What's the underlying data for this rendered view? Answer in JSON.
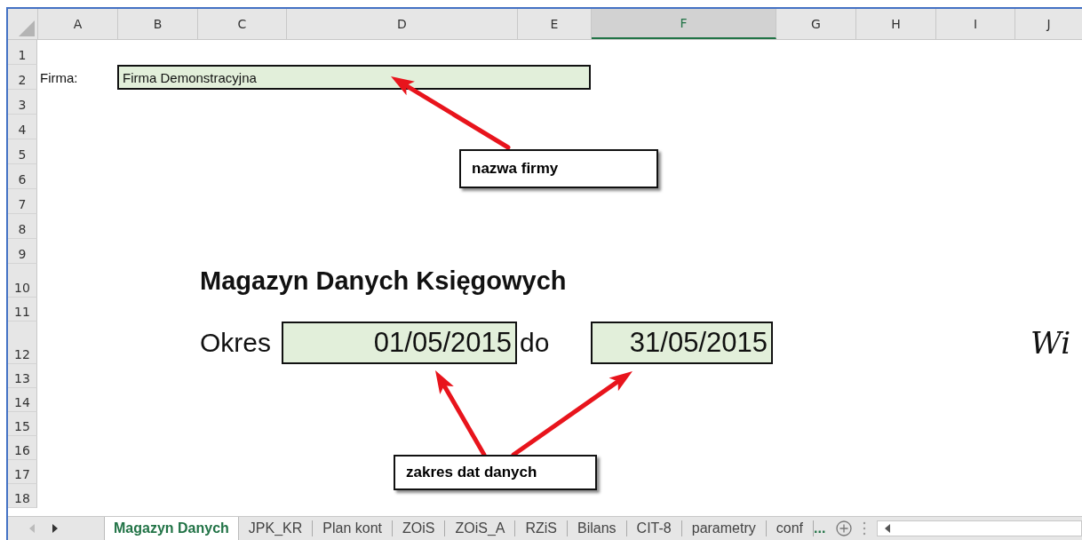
{
  "columns": [
    {
      "label": "A",
      "selected": false
    },
    {
      "label": "B",
      "selected": false
    },
    {
      "label": "C",
      "selected": false
    },
    {
      "label": "D",
      "selected": false
    },
    {
      "label": "E",
      "selected": false
    },
    {
      "label": "F",
      "selected": true
    },
    {
      "label": "G",
      "selected": false
    },
    {
      "label": "H",
      "selected": false
    },
    {
      "label": "I",
      "selected": false
    },
    {
      "label": "J",
      "selected": false
    }
  ],
  "rows": [
    "1",
    "2",
    "3",
    "4",
    "5",
    "6",
    "7",
    "8",
    "9",
    "10",
    "11",
    "12",
    "13",
    "14",
    "15",
    "16",
    "17",
    "18"
  ],
  "cells": {
    "company_label": "Firma:",
    "company_name": "Firma Demonstracyjna",
    "title": "Magazyn Danych Księgowych",
    "period_label": "Okres",
    "date_from": "01/05/2015",
    "to_label": "do",
    "date_to": "31/05/2015",
    "side_text": "Wi"
  },
  "callouts": [
    {
      "text": "nazwa firmy"
    },
    {
      "text": "zakres dat danych"
    }
  ],
  "sheet_tabs": [
    {
      "label": "Magazyn Danych",
      "selected": true
    },
    {
      "label": "JPK_KR",
      "selected": false
    },
    {
      "label": "Plan kont",
      "selected": false
    },
    {
      "label": "ZOiS",
      "selected": false
    },
    {
      "label": "ZOiS_A",
      "selected": false
    },
    {
      "label": "RZiS",
      "selected": false
    },
    {
      "label": "Bilans",
      "selected": false
    },
    {
      "label": "CIT-8",
      "selected": false
    },
    {
      "label": "parametry",
      "selected": false
    },
    {
      "label": "conf",
      "selected": false
    }
  ],
  "more_tabs": "..."
}
